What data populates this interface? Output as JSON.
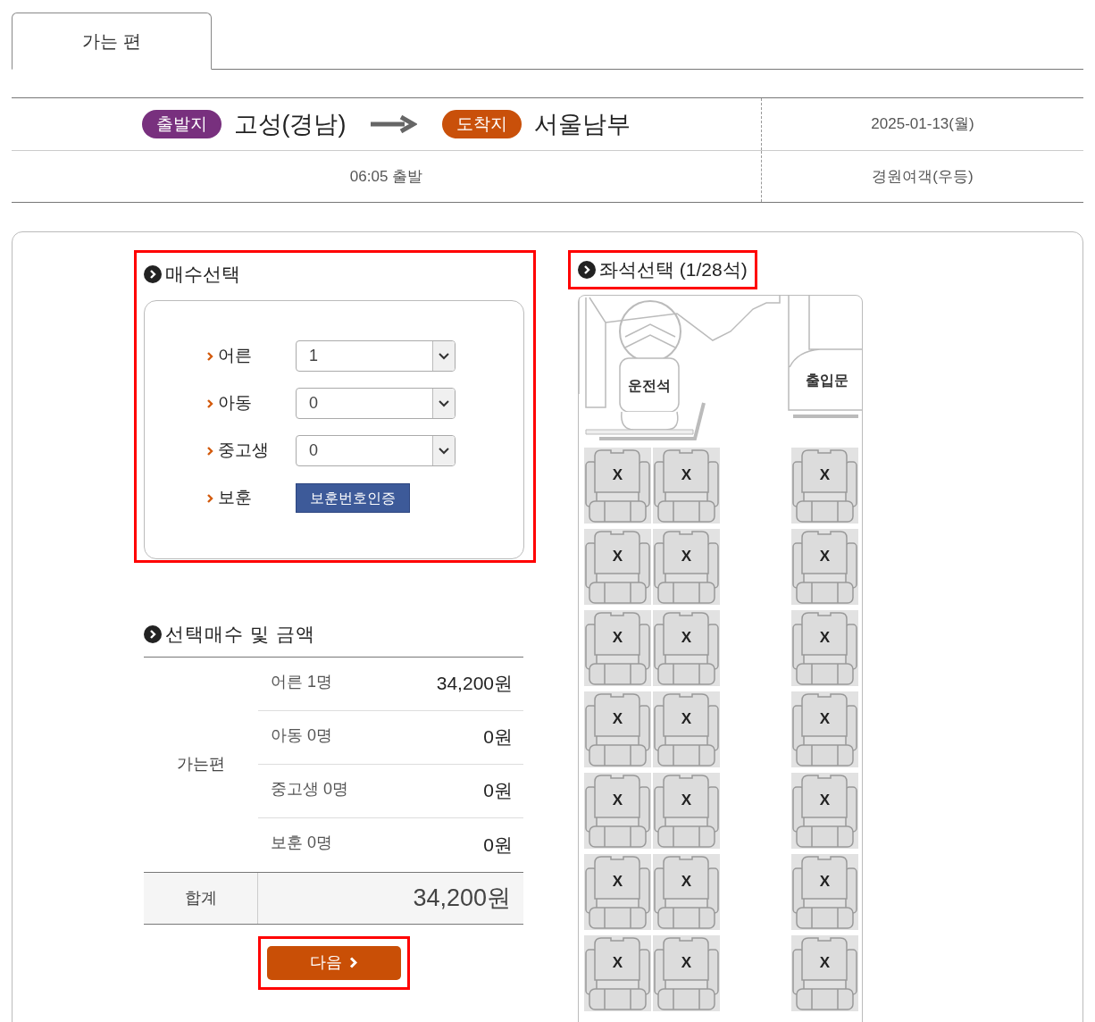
{
  "tabs": [
    {
      "label": "가는 편",
      "selected": true
    }
  ],
  "route": {
    "origin_badge": "출발지",
    "origin": "고성(경남)",
    "destination_badge": "도착지",
    "destination": "서울남부",
    "date": "2025-01-13(월)",
    "departure": "06:05 출발",
    "company": "경원여객(우등)"
  },
  "quantity": {
    "title": "매수선택",
    "highlighted": true,
    "rows": [
      {
        "kind": "select",
        "label": "어른",
        "value": "1"
      },
      {
        "kind": "select",
        "label": "아동",
        "value": "0"
      },
      {
        "kind": "select",
        "label": "중고생",
        "value": "0"
      },
      {
        "kind": "button",
        "label": "보훈",
        "value": "보훈번호인증"
      }
    ]
  },
  "summary": {
    "title": "선택매수 및 금액",
    "group": "가는편",
    "rows": [
      {
        "label": "어른 1명",
        "amount": "34,200원"
      },
      {
        "label": "아동 0명",
        "amount": "0원"
      },
      {
        "label": "중고생 0명",
        "amount": "0원"
      },
      {
        "label": "보훈 0명",
        "amount": "0원"
      }
    ],
    "total_label": "합계",
    "total": "34,200원"
  },
  "next_button": {
    "label": "다음",
    "highlighted": true
  },
  "seat_map": {
    "title": "좌석선택 (1/28석)",
    "highlighted": true,
    "driver_label": "운전석",
    "door_label": "출입문",
    "rows": [
      {
        "left": [
          {
            "label": "X",
            "taken": true
          },
          {
            "label": "X",
            "taken": true
          }
        ],
        "right": [
          {
            "label": "X",
            "taken": true
          }
        ]
      },
      {
        "left": [
          {
            "label": "X",
            "taken": true
          },
          {
            "label": "X",
            "taken": true
          }
        ],
        "right": [
          {
            "label": "X",
            "taken": true
          }
        ]
      },
      {
        "left": [
          {
            "label": "X",
            "taken": true
          },
          {
            "label": "X",
            "taken": true
          }
        ],
        "right": [
          {
            "label": "X",
            "taken": true
          }
        ]
      },
      {
        "left": [
          {
            "label": "X",
            "taken": true
          },
          {
            "label": "X",
            "taken": true
          }
        ],
        "right": [
          {
            "label": "X",
            "taken": true
          }
        ]
      },
      {
        "left": [
          {
            "label": "X",
            "taken": true
          },
          {
            "label": "X",
            "taken": true
          }
        ],
        "right": [
          {
            "label": "X",
            "taken": true
          }
        ]
      },
      {
        "left": [
          {
            "label": "X",
            "taken": true
          },
          {
            "label": "X",
            "taken": true
          }
        ],
        "right": [
          {
            "label": "X",
            "taken": true
          }
        ]
      },
      {
        "left": [
          {
            "label": "X",
            "taken": true
          },
          {
            "label": "X",
            "taken": true
          }
        ],
        "right": [
          {
            "label": "X",
            "taken": true
          }
        ]
      }
    ]
  }
}
